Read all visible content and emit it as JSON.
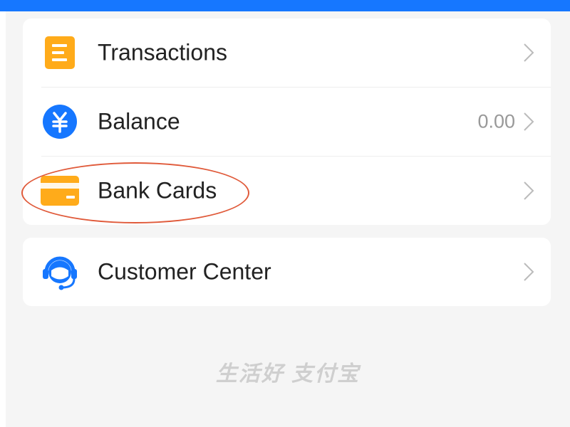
{
  "menu": {
    "items": [
      {
        "label": "Transactions",
        "icon": "transactions-icon",
        "value": ""
      },
      {
        "label": "Balance",
        "icon": "yuan-icon",
        "value": "0.00"
      },
      {
        "label": "Bank Cards",
        "icon": "bank-card-icon",
        "value": ""
      }
    ]
  },
  "support": {
    "label": "Customer Center",
    "icon": "customer-service-icon"
  },
  "footer": {
    "slogan": "生活好 支付宝"
  },
  "colors": {
    "accent_blue": "#1677ff",
    "icon_orange": "#ffab1a",
    "highlight_red": "#e05a3a",
    "background": "#f5f5f5"
  }
}
